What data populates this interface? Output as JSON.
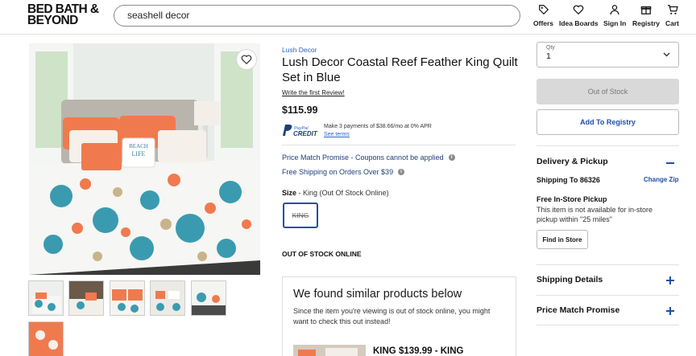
{
  "header": {
    "logo_line1": "BED BATH &",
    "logo_line2": "BEYOND",
    "search_value": "seashell decor",
    "nav": [
      {
        "label": "Offers",
        "icon": "tag-icon"
      },
      {
        "label": "Idea Boards",
        "icon": "heart-icon"
      },
      {
        "label": "Sign In",
        "icon": "person-icon"
      },
      {
        "label": "Registry",
        "icon": "gift-icon"
      },
      {
        "label": "Cart",
        "icon": "cart-icon"
      }
    ]
  },
  "product": {
    "brand": "Lush Decor",
    "title": "Lush Decor Coastal Reef Feather King Quilt Set in Blue",
    "review_link": "Write the first Review!",
    "price": "$115.99",
    "credit": {
      "logo_top": "PayPal",
      "logo_bottom": "CREDIT",
      "text": "Make 3 payments of $38.66/mo at 0% APR",
      "terms_link": "See terms"
    },
    "promos": [
      {
        "text": "Price Match Promise - Coupons cannot be applied",
        "icon": "info-icon"
      },
      {
        "text": "Free Shipping on Orders Over $39",
        "icon": "info-icon"
      }
    ],
    "size": {
      "label": "Size",
      "selected_text": "- King (Out Of Stock Online)",
      "option": "KING"
    },
    "stock_status": "OUT OF STOCK ONLINE",
    "image_pillow_text_1": "BEACH",
    "image_pillow_text_2": "LIFE"
  },
  "similar": {
    "heading": "We found similar products below",
    "description": "Since the item you're viewing is out of stock online, you might want to check this out instead!",
    "item_price": "KING $139.99 - KING"
  },
  "purchase": {
    "qty_label": "Qty",
    "qty_value": "1",
    "out_of_stock_button": "Out of Stock",
    "add_to_registry_button": "Add To Registry"
  },
  "delivery": {
    "title": "Delivery & Pickup",
    "ship_to": "Shipping To 86326",
    "change_zip": "Change Zip",
    "pickup_title": "Free In-Store Pickup",
    "pickup_text": "This item is not available for in-store pickup within \"25 miles\"",
    "find_button": "Find in Store"
  },
  "sections": [
    {
      "title": "Shipping Details"
    },
    {
      "title": "Price Match Promise"
    }
  ],
  "colors": {
    "accent_blue": "#1f4fa7",
    "link_blue": "#2a63c9",
    "coral": "#f07a4e",
    "teal": "#3a9bb0"
  }
}
